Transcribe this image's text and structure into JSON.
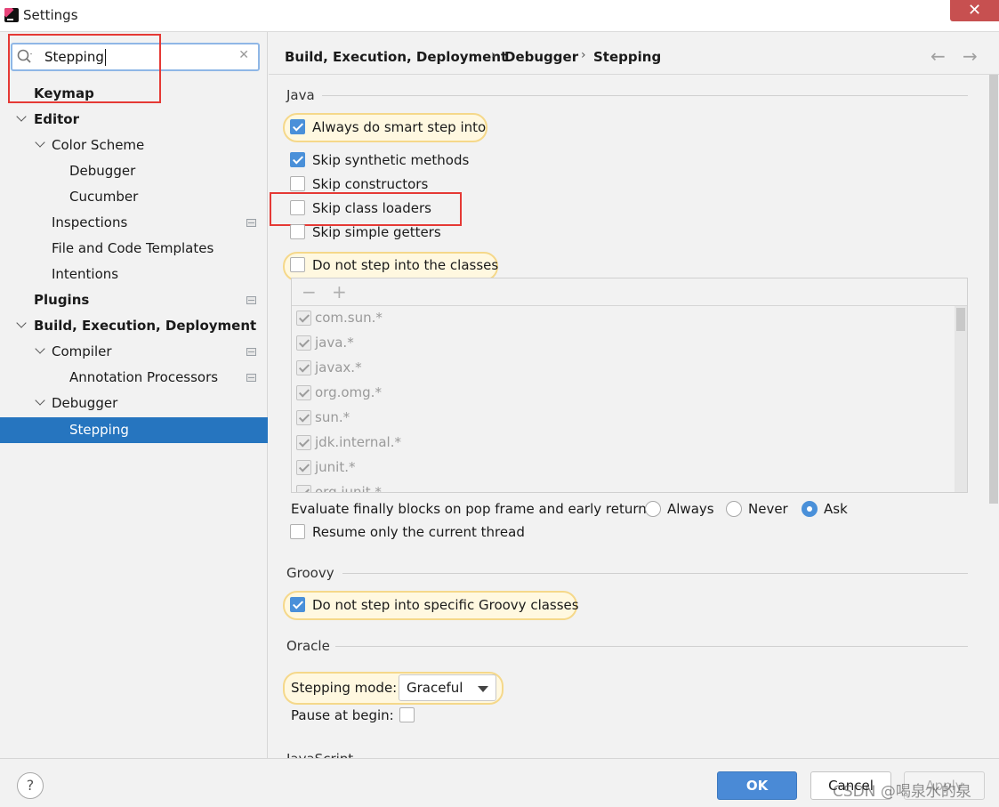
{
  "window": {
    "title": "Settings",
    "close_glyph": "✕"
  },
  "search": {
    "value": "Stepping"
  },
  "sidebar": {
    "items": [
      {
        "label": "Keymap"
      },
      {
        "label": "Editor"
      },
      {
        "label": "Color Scheme"
      },
      {
        "label": "Debugger"
      },
      {
        "label": "Cucumber"
      },
      {
        "label": "Inspections"
      },
      {
        "label": "File and Code Templates"
      },
      {
        "label": "Intentions"
      },
      {
        "label": "Plugins"
      },
      {
        "label": "Build, Execution, Deployment"
      },
      {
        "label": "Compiler"
      },
      {
        "label": "Annotation Processors"
      },
      {
        "label": "Debugger"
      },
      {
        "label": "Stepping"
      }
    ]
  },
  "breadcrumb": {
    "items": [
      "Build, Execution, Deployment",
      "Debugger",
      "Stepping"
    ],
    "sep": "›",
    "back": "←",
    "forward": "→"
  },
  "java": {
    "title": "Java",
    "always_smart_step": "Always do smart step into",
    "skip_synthetic": "Skip synthetic methods",
    "skip_constructors": "Skip constructors",
    "skip_class_loaders": "Skip class loaders",
    "skip_simple_getters": "Skip simple getters",
    "do_not_step_classes": "Do not step into the classes",
    "list_minus": "−",
    "list_plus": "+",
    "classes": [
      "com.sun.*",
      "java.*",
      "javax.*",
      "org.omg.*",
      "sun.*",
      "jdk.internal.*",
      "junit.*",
      "org.junit.*"
    ],
    "evaluate_finally": "Evaluate finally blocks on pop frame and early return:",
    "radio_always": "Always",
    "radio_never": "Never",
    "radio_ask": "Ask",
    "resume_thread": "Resume only the current thread"
  },
  "groovy": {
    "title": "Groovy",
    "do_not_step_groovy": "Do not step into specific Groovy classes"
  },
  "oracle": {
    "title": "Oracle",
    "stepping_mode_label": "Stepping mode:",
    "stepping_mode_value": "Graceful",
    "pause_at_begin": "Pause at begin:"
  },
  "javascript": {
    "title": "JavaScript"
  },
  "footer": {
    "help": "?",
    "ok": "OK",
    "cancel": "Cancel",
    "apply": "Apply",
    "watermark": "CSDN @喝泉水的泉"
  }
}
